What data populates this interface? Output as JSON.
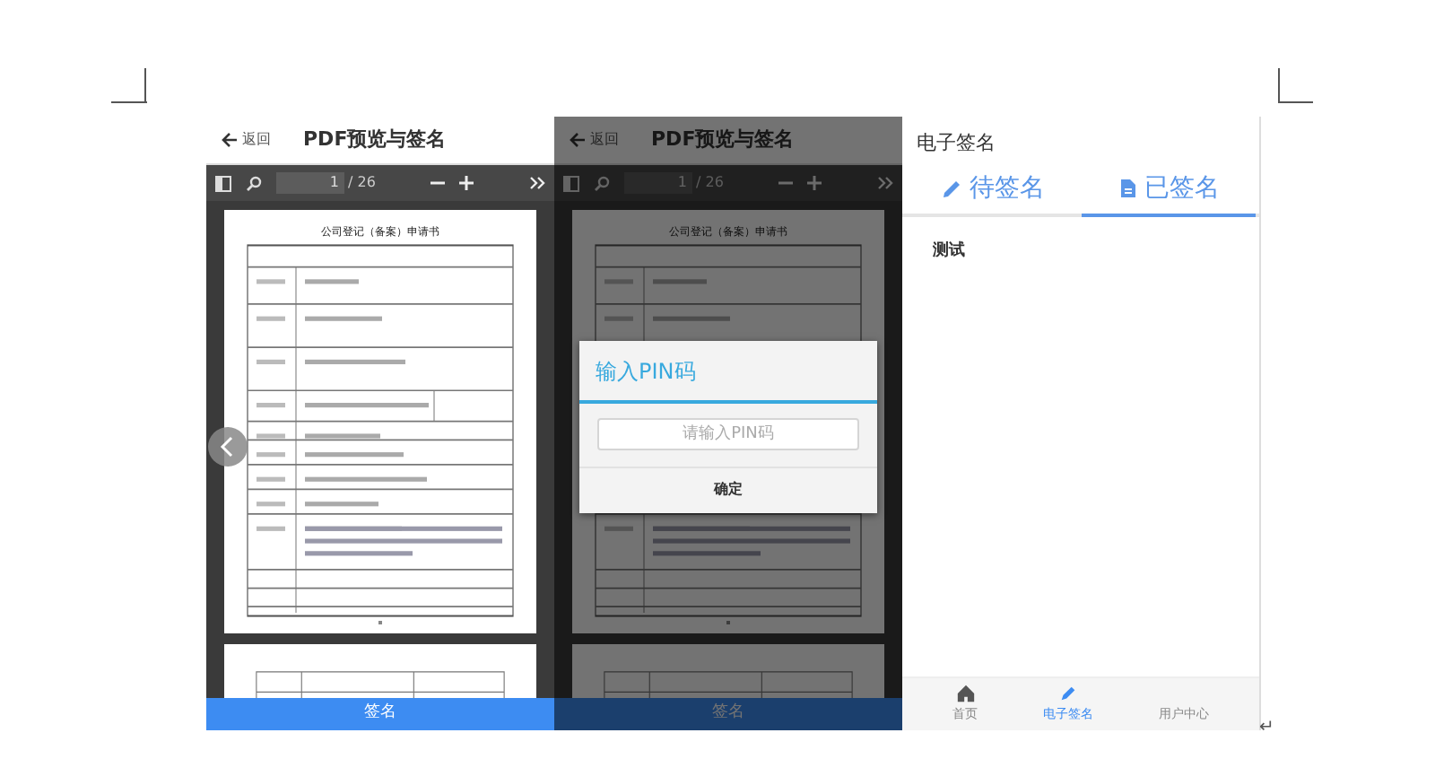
{
  "screens": [
    {
      "kind": "pdf_viewer",
      "dimmed": false,
      "back": "返回",
      "title": "PDF预览与签名",
      "page": "1",
      "total": "/ 26",
      "document_title": "公司登记（备案）申请书",
      "sign_button": "签名"
    },
    {
      "kind": "pdf_viewer",
      "dimmed": true,
      "back": "返回",
      "title": "PDF预览与签名",
      "page": "1",
      "total": "/ 26",
      "document_title": "公司登记（备案）申请书",
      "sign_button": "签名",
      "dialog": {
        "title": "输入PIN码",
        "placeholder": "请输入PIN码",
        "confirm": "确定"
      }
    },
    {
      "kind": "signature_list",
      "title": "电子签名",
      "tabs": [
        {
          "label": "待签名",
          "selected": false
        },
        {
          "label": "已签名",
          "selected": true
        }
      ],
      "items": [
        "测试"
      ],
      "nav": [
        {
          "label": "首页",
          "selected": false
        },
        {
          "label": "电子签名",
          "selected": true
        },
        {
          "label": "用户中心",
          "selected": false
        }
      ]
    }
  ],
  "paragraph_mark": "↵"
}
